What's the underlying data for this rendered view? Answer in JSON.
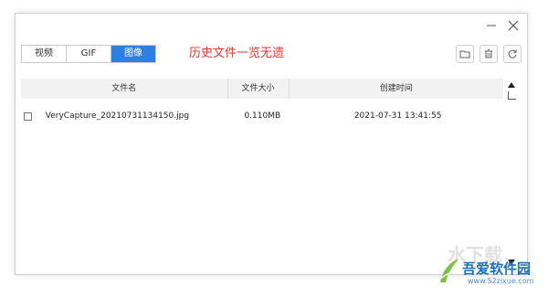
{
  "window": {
    "controls": {
      "minimize_icon": "minimize-icon",
      "close_icon": "close-icon"
    }
  },
  "tabs": [
    {
      "label": "视频",
      "active": false
    },
    {
      "label": "GIF",
      "active": false
    },
    {
      "label": "图像",
      "active": true
    }
  ],
  "notice": "历史文件一览无遗",
  "actions": {
    "open_folder_icon": "folder-icon",
    "delete_icon": "trash-icon",
    "refresh_icon": "refresh-icon"
  },
  "table": {
    "headers": {
      "name": "文件名",
      "size": "文件大小",
      "created": "创建时间"
    },
    "rows": [
      {
        "name": "VeryCapture_20210731134150.jpg",
        "size": "0.110MB",
        "created": "2021-07-31 13:41:55",
        "checked": false
      }
    ]
  },
  "watermark": {
    "ghost": "水下载",
    "title": "吾爱软件园",
    "url": "www.52zixue.com"
  },
  "colors": {
    "accent": "#2f7fe0",
    "notice": "#e03a2f"
  }
}
